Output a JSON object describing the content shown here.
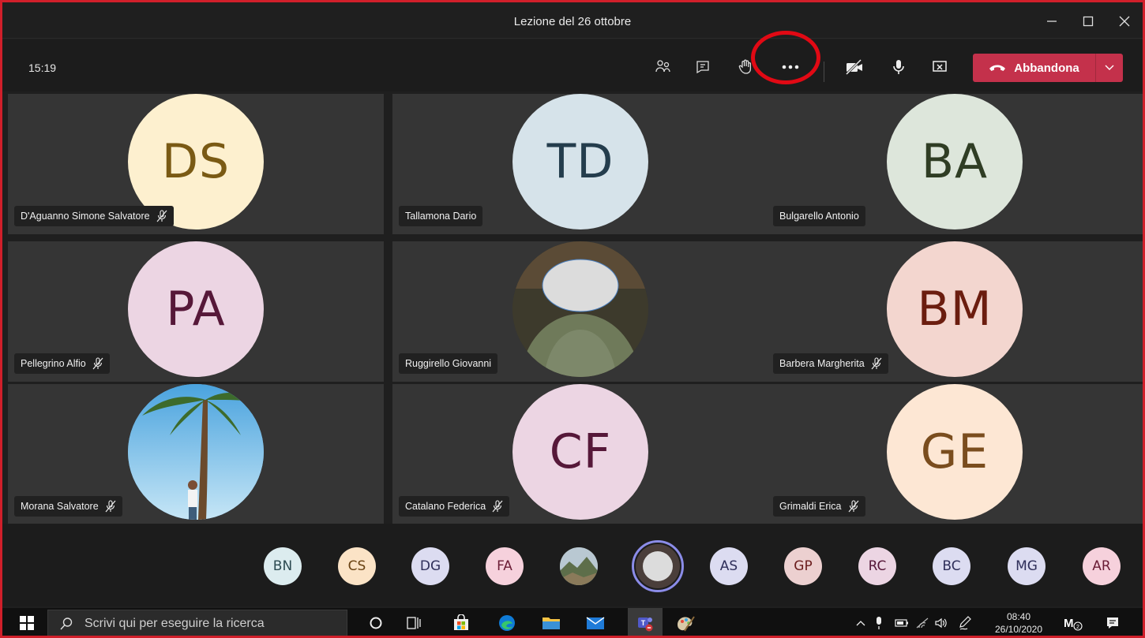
{
  "window": {
    "title": "Lezione del 26 ottobre",
    "controls": [
      "minimize-icon",
      "maximize-icon",
      "close-icon"
    ]
  },
  "toolbar": {
    "time": "15:19",
    "icons": [
      "people-icon",
      "chat-icon",
      "raise-hand-icon",
      "more-options-icon",
      "camera-off-icon",
      "microphone-icon",
      "share-screen-icon"
    ],
    "leave_label": "Abbandona",
    "leave_color": "#c4314b",
    "highlight_color": "#e10914"
  },
  "participants": [
    {
      "initials": "DS",
      "name": "D'Aguanno Simone Salvatore",
      "muted": true,
      "bg": "#fdf0cf",
      "fg": "#7a5a14",
      "type": "initials"
    },
    {
      "initials": "TD",
      "name": "Tallamona Dario",
      "muted": false,
      "bg": "#d6e3ea",
      "fg": "#243d4d",
      "type": "initials"
    },
    {
      "initials": "BA",
      "name": "Bulgarello Antonio",
      "muted": false,
      "bg": "#dde6db",
      "fg": "#2f3d24",
      "type": "initials"
    },
    {
      "initials": "PA",
      "name": "Pellegrino Alfio",
      "muted": true,
      "bg": "#ecd5e3",
      "fg": "#561839",
      "type": "initials"
    },
    {
      "initials": "",
      "name": "Ruggirello Giovanni",
      "muted": false,
      "bg": "#3d3a2c",
      "fg": "#ffffff",
      "type": "photo-person"
    },
    {
      "initials": "BM",
      "name": "Barbera Margherita",
      "muted": true,
      "bg": "#f3d6cf",
      "fg": "#6b1d0f",
      "type": "initials"
    },
    {
      "initials": "",
      "name": "Morana Salvatore",
      "muted": true,
      "bg": "#6fb8e6",
      "fg": "#ffffff",
      "type": "photo-palm"
    },
    {
      "initials": "CF",
      "name": "Catalano Federica",
      "muted": true,
      "bg": "#ecd5e3",
      "fg": "#561839",
      "type": "initials"
    },
    {
      "initials": "GE",
      "name": "Grimaldi Erica",
      "muted": true,
      "bg": "#fde7d4",
      "fg": "#7a4d1e",
      "type": "initials"
    }
  ],
  "others": [
    {
      "initials": "BN",
      "bg": "#dcecef",
      "fg": "#2d4b52"
    },
    {
      "initials": "CS",
      "bg": "#fbe3c6",
      "fg": "#6a4313"
    },
    {
      "initials": "DG",
      "bg": "#dcdcf1",
      "fg": "#2f2f5a"
    },
    {
      "initials": "FA",
      "bg": "#f6d1dc",
      "fg": "#6b1d36"
    },
    {
      "initials": "",
      "bg": "#7c8a6a",
      "fg": "#ffffff"
    },
    {
      "initials": "",
      "bg": "#5a4a44",
      "fg": "#ffffff"
    },
    {
      "initials": "AS",
      "bg": "#dcdcf1",
      "fg": "#2f2f5a"
    },
    {
      "initials": "GP",
      "bg": "#ecd0d0",
      "fg": "#6b1d1d"
    },
    {
      "initials": "RC",
      "bg": "#ecd5e3",
      "fg": "#561839"
    },
    {
      "initials": "BC",
      "bg": "#dcdcf1",
      "fg": "#2f2f5a"
    },
    {
      "initials": "MG",
      "bg": "#dcdcf1",
      "fg": "#2f2f5a"
    },
    {
      "initials": "AR",
      "bg": "#f6d1dc",
      "fg": "#6b1d36"
    }
  ],
  "taskbar": {
    "search_placeholder": "Scrivi qui per eseguire la ricerca",
    "apps": [
      "cortana-icon",
      "task-view-icon",
      "store-icon",
      "edge-icon",
      "file-explorer-icon",
      "mail-icon",
      "teams-icon",
      "paint-icon"
    ],
    "time": "08:40",
    "date": "26/10/2020"
  }
}
